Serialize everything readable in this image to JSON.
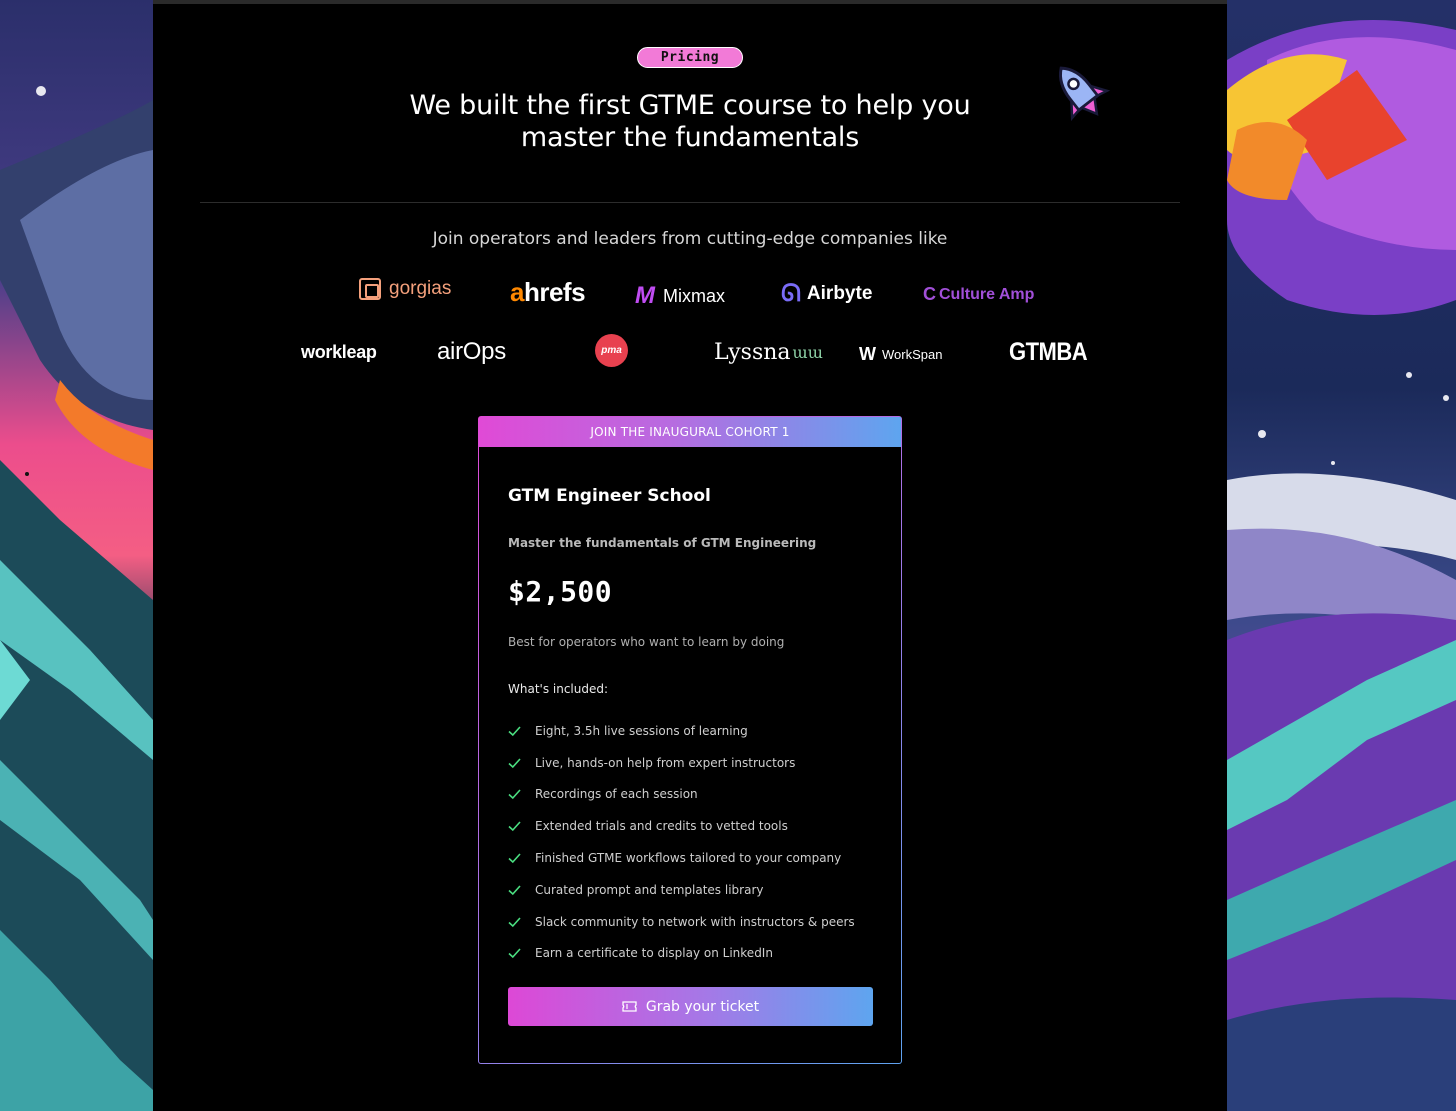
{
  "pricing_badge": "Pricing",
  "headline": {
    "line1": "We built the first GTME course to help you",
    "line2": "master the fundamentals"
  },
  "companies": {
    "intro": "Join operators and leaders from cutting-edge companies like",
    "row1": {
      "gorgias": "gorgias",
      "ahrefs_a": "a",
      "ahrefs_rest": "hrefs",
      "mixmax": "Mixmax",
      "airbyte": "Airbyte",
      "culture_amp": "Culture Amp"
    },
    "row2": {
      "workleap": "workleap",
      "airops": "airOps",
      "pma": "pma",
      "lyssna": "Lyssna",
      "workspan": "WorkSpan",
      "gtmba": "GTMBA"
    }
  },
  "card": {
    "header": "JOIN THE INAUGURAL COHORT 1",
    "title": "GTM Engineer School",
    "subtitle": "Master the fundamentals of GTM Engineering",
    "price": "$2,500",
    "best_for": "Best for operators who want to learn by doing",
    "included_label": "What's included:",
    "features": [
      "Eight, 3.5h live sessions of learning",
      "Live, hands-on help from expert instructors",
      "Recordings of each session",
      "Extended trials and credits to vetted tools",
      "Finished GTME workflows tailored to your company",
      "Curated prompt and templates library",
      "Slack community to network with instructors & peers",
      "Earn a certificate to display on LinkedIn"
    ],
    "cta_label": "Grab your ticket"
  },
  "colors": {
    "accent_pink": "#e04ad6",
    "accent_blue": "#5ea5ef",
    "check_green": "#4ade80",
    "badge_pink": "#f27ad7"
  }
}
